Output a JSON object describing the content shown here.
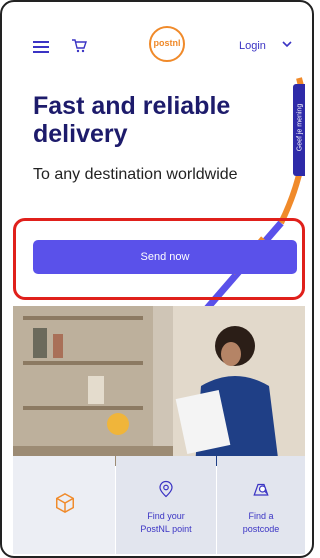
{
  "header": {
    "logo_text": "postnl",
    "login_label": "Login"
  },
  "hero": {
    "title": "Fast and reliable delivery",
    "subtitle": "To any destination worldwide",
    "side_tab": "Geef je mening"
  },
  "cta": {
    "send_label": "Send now"
  },
  "tiles": [
    {
      "label": "",
      "icon": "parcel-icon"
    },
    {
      "label": "Find your\nPostNL point",
      "icon": "location-pin-icon"
    },
    {
      "label": "Find a\npostcode",
      "icon": "search-map-icon"
    }
  ],
  "colors": {
    "brand_blue": "#3b34c4",
    "button": "#5a51ea",
    "orange": "#f08a2a",
    "highlight_red": "#e0201b"
  }
}
